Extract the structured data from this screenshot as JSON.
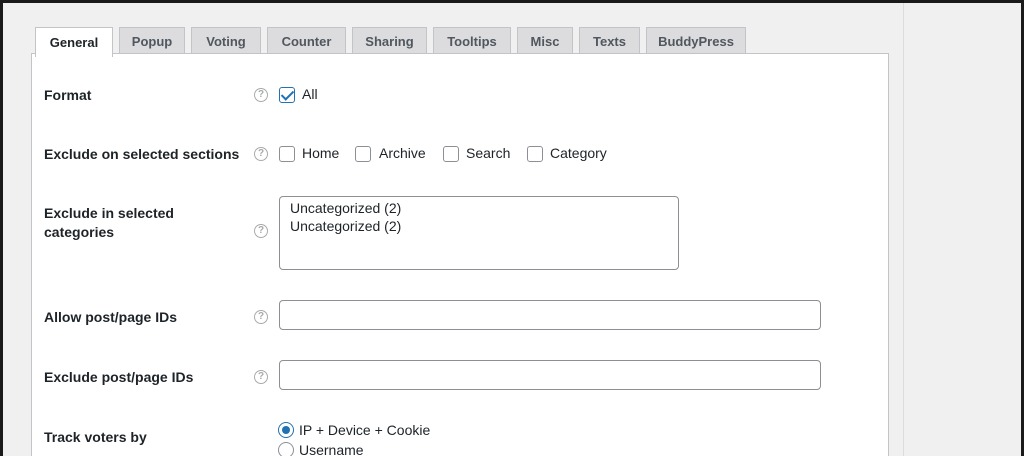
{
  "tabs": [
    {
      "label": "General",
      "active": true
    },
    {
      "label": "Popup"
    },
    {
      "label": "Voting"
    },
    {
      "label": "Counter"
    },
    {
      "label": "Sharing"
    },
    {
      "label": "Tooltips"
    },
    {
      "label": "Misc"
    },
    {
      "label": "Texts"
    },
    {
      "label": "BuddyPress"
    }
  ],
  "help_glyph": "?",
  "format": {
    "label": "Format",
    "options": [
      {
        "label": "All",
        "checked": true
      }
    ]
  },
  "exclude_sections": {
    "label": "Exclude on selected sections",
    "options": [
      {
        "label": "Home",
        "checked": false
      },
      {
        "label": "Archive",
        "checked": false
      },
      {
        "label": "Search",
        "checked": false
      },
      {
        "label": "Category",
        "checked": false
      }
    ]
  },
  "exclude_categories": {
    "label_line1": "Exclude in selected",
    "label_line2": "categories",
    "items": [
      "Uncategorized (2)",
      "Uncategorized (2)"
    ]
  },
  "allow_ids": {
    "label": "Allow post/page IDs",
    "value": ""
  },
  "exclude_ids": {
    "label": "Exclude post/page IDs",
    "value": ""
  },
  "track_voters": {
    "label": "Track voters by",
    "options": [
      {
        "label": "IP + Device + Cookie",
        "checked": true
      },
      {
        "label": "Username",
        "checked": false
      }
    ]
  },
  "colors": {
    "accent": "#2271b1",
    "border": "#8c8f94",
    "tab_bg": "#dcdcde"
  }
}
